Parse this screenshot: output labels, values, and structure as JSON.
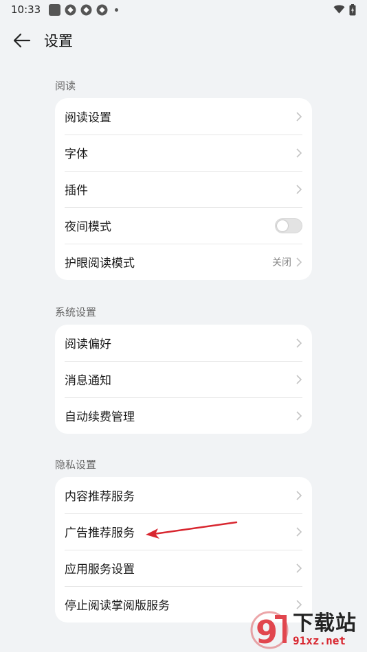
{
  "status_bar": {
    "time": "10:33",
    "icons": [
      "square-icon",
      "app-icon",
      "app-icon",
      "app-icon",
      "dot-icon"
    ],
    "right_icons": [
      "wifi-icon",
      "battery-icon"
    ]
  },
  "header": {
    "title": "设置",
    "back_icon": "arrow-left-icon"
  },
  "sections": {
    "reading": {
      "title": "阅读",
      "items": [
        {
          "label": "阅读设置"
        },
        {
          "label": "字体"
        },
        {
          "label": "插件"
        },
        {
          "label": "夜间模式",
          "toggle": false
        },
        {
          "label": "护眼阅读模式",
          "value": "关闭"
        }
      ]
    },
    "system": {
      "title": "系统设置",
      "items": [
        {
          "label": "阅读偏好"
        },
        {
          "label": "消息通知"
        },
        {
          "label": "自动续费管理"
        }
      ]
    },
    "privacy": {
      "title": "隐私设置",
      "items": [
        {
          "label": "内容推荐服务"
        },
        {
          "label": "广告推荐服务"
        },
        {
          "label": "应用服务设置"
        },
        {
          "label": "停止阅读掌阅版服务"
        }
      ]
    }
  },
  "watermark": {
    "logo_text": "9",
    "brand": "下载站",
    "url": "91xz.net"
  },
  "colors": {
    "background": "#f1f3f5",
    "card": "#ffffff",
    "annotation": "#d8262f"
  }
}
